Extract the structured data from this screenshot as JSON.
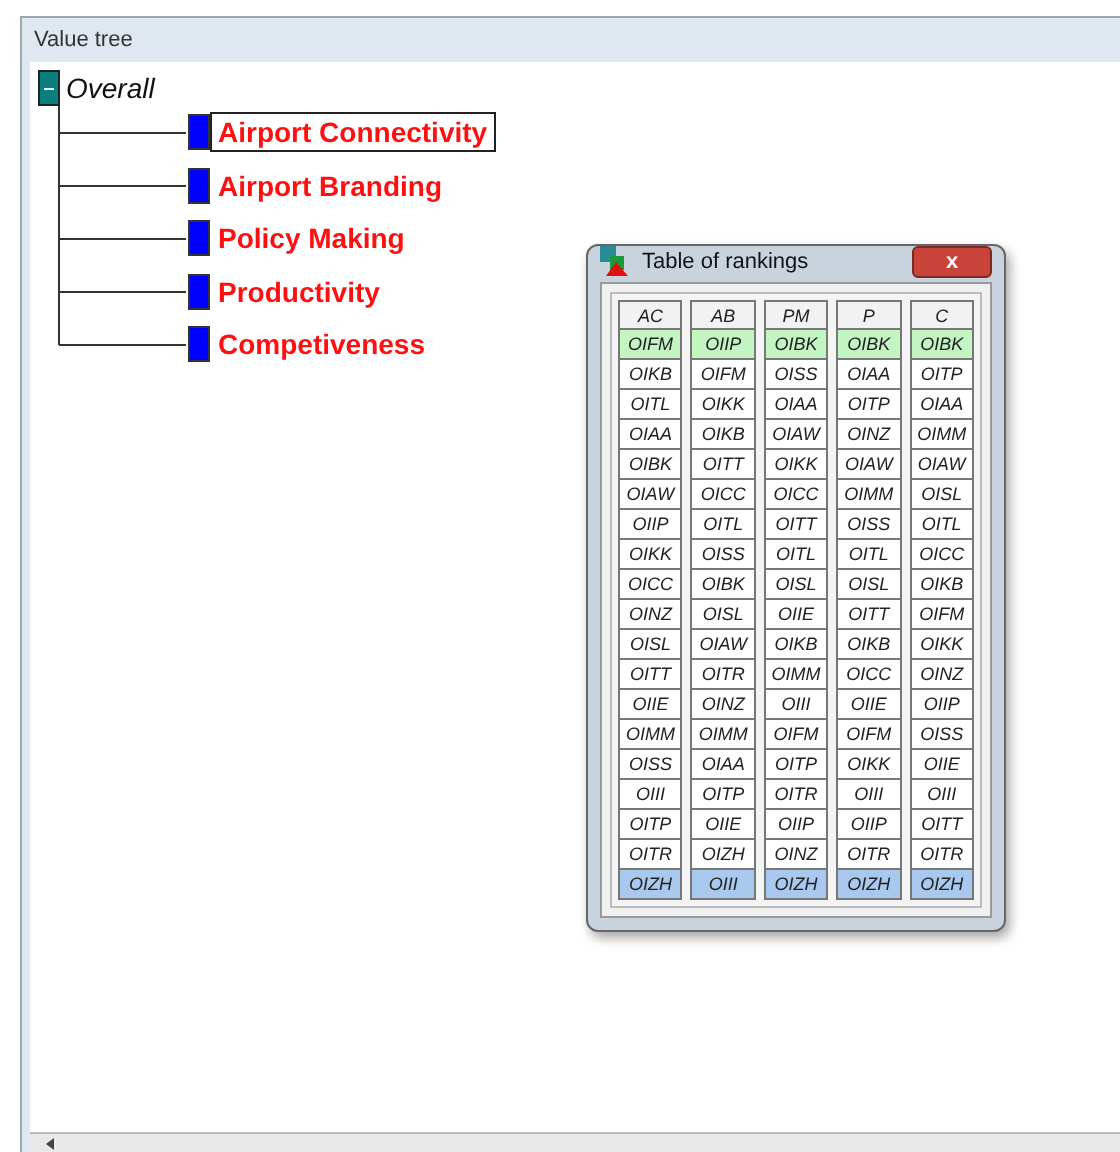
{
  "window": {
    "title": "Value tree"
  },
  "tree": {
    "label": "Overall",
    "expanded": true,
    "children": [
      {
        "label": "Airport Connectivity",
        "selected": true
      },
      {
        "label": "Airport Branding",
        "selected": false
      },
      {
        "label": "Policy Making",
        "selected": false
      },
      {
        "label": "Productivity",
        "selected": false
      },
      {
        "label": "Competiveness",
        "selected": false
      }
    ]
  },
  "dialog": {
    "title": "Table of rankings",
    "close": "x",
    "columns": [
      {
        "header": "AC",
        "cells": [
          {
            "text": "OIFM",
            "kind": "best"
          },
          {
            "text": "OIKB",
            "kind": "mid"
          },
          {
            "text": "OITL",
            "kind": "mid"
          },
          {
            "text": "OIAA",
            "kind": "mid"
          },
          {
            "text": "OIBK",
            "kind": "mid"
          },
          {
            "text": "OIAW",
            "kind": "mid"
          },
          {
            "text": "OIIP",
            "kind": "mid"
          },
          {
            "text": "OIKK",
            "kind": "mid"
          },
          {
            "text": "OICC",
            "kind": "mid"
          },
          {
            "text": "OINZ",
            "kind": "mid"
          },
          {
            "text": "OISL",
            "kind": "mid"
          },
          {
            "text": "OITT",
            "kind": "mid"
          },
          {
            "text": "OIIE",
            "kind": "mid"
          },
          {
            "text": "OIMM",
            "kind": "mid"
          },
          {
            "text": "OISS",
            "kind": "mid"
          },
          {
            "text": "OIII",
            "kind": "mid"
          },
          {
            "text": "OITP",
            "kind": "mid"
          },
          {
            "text": "OITR",
            "kind": "mid"
          },
          {
            "text": "OIZH",
            "kind": "worst"
          }
        ]
      },
      {
        "header": "AB",
        "cells": [
          {
            "text": "OIIP",
            "kind": "best"
          },
          {
            "text": "OIFM",
            "kind": "mid"
          },
          {
            "text": "OIKK",
            "kind": "mid"
          },
          {
            "text": "OIKB",
            "kind": "mid"
          },
          {
            "text": "OITT",
            "kind": "mid"
          },
          {
            "text": "OICC",
            "kind": "mid"
          },
          {
            "text": "OITL",
            "kind": "mid"
          },
          {
            "text": "OISS",
            "kind": "mid"
          },
          {
            "text": "OIBK",
            "kind": "mid"
          },
          {
            "text": "OISL",
            "kind": "mid"
          },
          {
            "text": "OIAW",
            "kind": "mid"
          },
          {
            "text": "OITR",
            "kind": "mid"
          },
          {
            "text": "OINZ",
            "kind": "mid"
          },
          {
            "text": "OIMM",
            "kind": "mid"
          },
          {
            "text": "OIAA",
            "kind": "mid"
          },
          {
            "text": "OITP",
            "kind": "mid"
          },
          {
            "text": "OIIE",
            "kind": "mid"
          },
          {
            "text": "OIZH",
            "kind": "mid"
          },
          {
            "text": "OIII",
            "kind": "worst"
          }
        ]
      },
      {
        "header": "PM",
        "cells": [
          {
            "text": "OIBK",
            "kind": "best"
          },
          {
            "text": "OISS",
            "kind": "mid"
          },
          {
            "text": "OIAA",
            "kind": "mid"
          },
          {
            "text": "OIAW",
            "kind": "mid"
          },
          {
            "text": "OIKK",
            "kind": "mid"
          },
          {
            "text": "OICC",
            "kind": "mid"
          },
          {
            "text": "OITT",
            "kind": "mid"
          },
          {
            "text": "OITL",
            "kind": "mid"
          },
          {
            "text": "OISL",
            "kind": "mid"
          },
          {
            "text": "OIIE",
            "kind": "mid"
          },
          {
            "text": "OIKB",
            "kind": "mid"
          },
          {
            "text": "OIMM",
            "kind": "mid"
          },
          {
            "text": "OIII",
            "kind": "mid"
          },
          {
            "text": "OIFM",
            "kind": "mid"
          },
          {
            "text": "OITP",
            "kind": "mid"
          },
          {
            "text": "OITR",
            "kind": "mid"
          },
          {
            "text": "OIIP",
            "kind": "mid"
          },
          {
            "text": "OINZ",
            "kind": "mid"
          },
          {
            "text": "OIZH",
            "kind": "worst"
          }
        ]
      },
      {
        "header": "P",
        "cells": [
          {
            "text": "OIBK",
            "kind": "best"
          },
          {
            "text": "OIAA",
            "kind": "mid"
          },
          {
            "text": "OITP",
            "kind": "mid"
          },
          {
            "text": "OINZ",
            "kind": "mid"
          },
          {
            "text": "OIAW",
            "kind": "mid"
          },
          {
            "text": "OIMM",
            "kind": "mid"
          },
          {
            "text": "OISS",
            "kind": "mid"
          },
          {
            "text": "OITL",
            "kind": "mid"
          },
          {
            "text": "OISL",
            "kind": "mid"
          },
          {
            "text": "OITT",
            "kind": "mid"
          },
          {
            "text": "OIKB",
            "kind": "mid"
          },
          {
            "text": "OICC",
            "kind": "mid"
          },
          {
            "text": "OIIE",
            "kind": "mid"
          },
          {
            "text": "OIFM",
            "kind": "mid"
          },
          {
            "text": "OIKK",
            "kind": "mid"
          },
          {
            "text": "OIII",
            "kind": "mid"
          },
          {
            "text": "OIIP",
            "kind": "mid"
          },
          {
            "text": "OITR",
            "kind": "mid"
          },
          {
            "text": "OIZH",
            "kind": "worst"
          }
        ]
      },
      {
        "header": "C",
        "cells": [
          {
            "text": "OIBK",
            "kind": "best"
          },
          {
            "text": "OITP",
            "kind": "mid"
          },
          {
            "text": "OIAA",
            "kind": "mid"
          },
          {
            "text": "OIMM",
            "kind": "mid"
          },
          {
            "text": "OIAW",
            "kind": "mid"
          },
          {
            "text": "OISL",
            "kind": "mid"
          },
          {
            "text": "OITL",
            "kind": "mid"
          },
          {
            "text": "OICC",
            "kind": "mid"
          },
          {
            "text": "OIKB",
            "kind": "mid"
          },
          {
            "text": "OIFM",
            "kind": "mid"
          },
          {
            "text": "OIKK",
            "kind": "mid"
          },
          {
            "text": "OINZ",
            "kind": "mid"
          },
          {
            "text": "OIIP",
            "kind": "mid"
          },
          {
            "text": "OISS",
            "kind": "mid"
          },
          {
            "text": "OIIE",
            "kind": "mid"
          },
          {
            "text": "OIII",
            "kind": "mid"
          },
          {
            "text": "OITT",
            "kind": "mid"
          },
          {
            "text": "OITR",
            "kind": "mid"
          },
          {
            "text": "OIZH",
            "kind": "worst"
          }
        ]
      }
    ]
  }
}
